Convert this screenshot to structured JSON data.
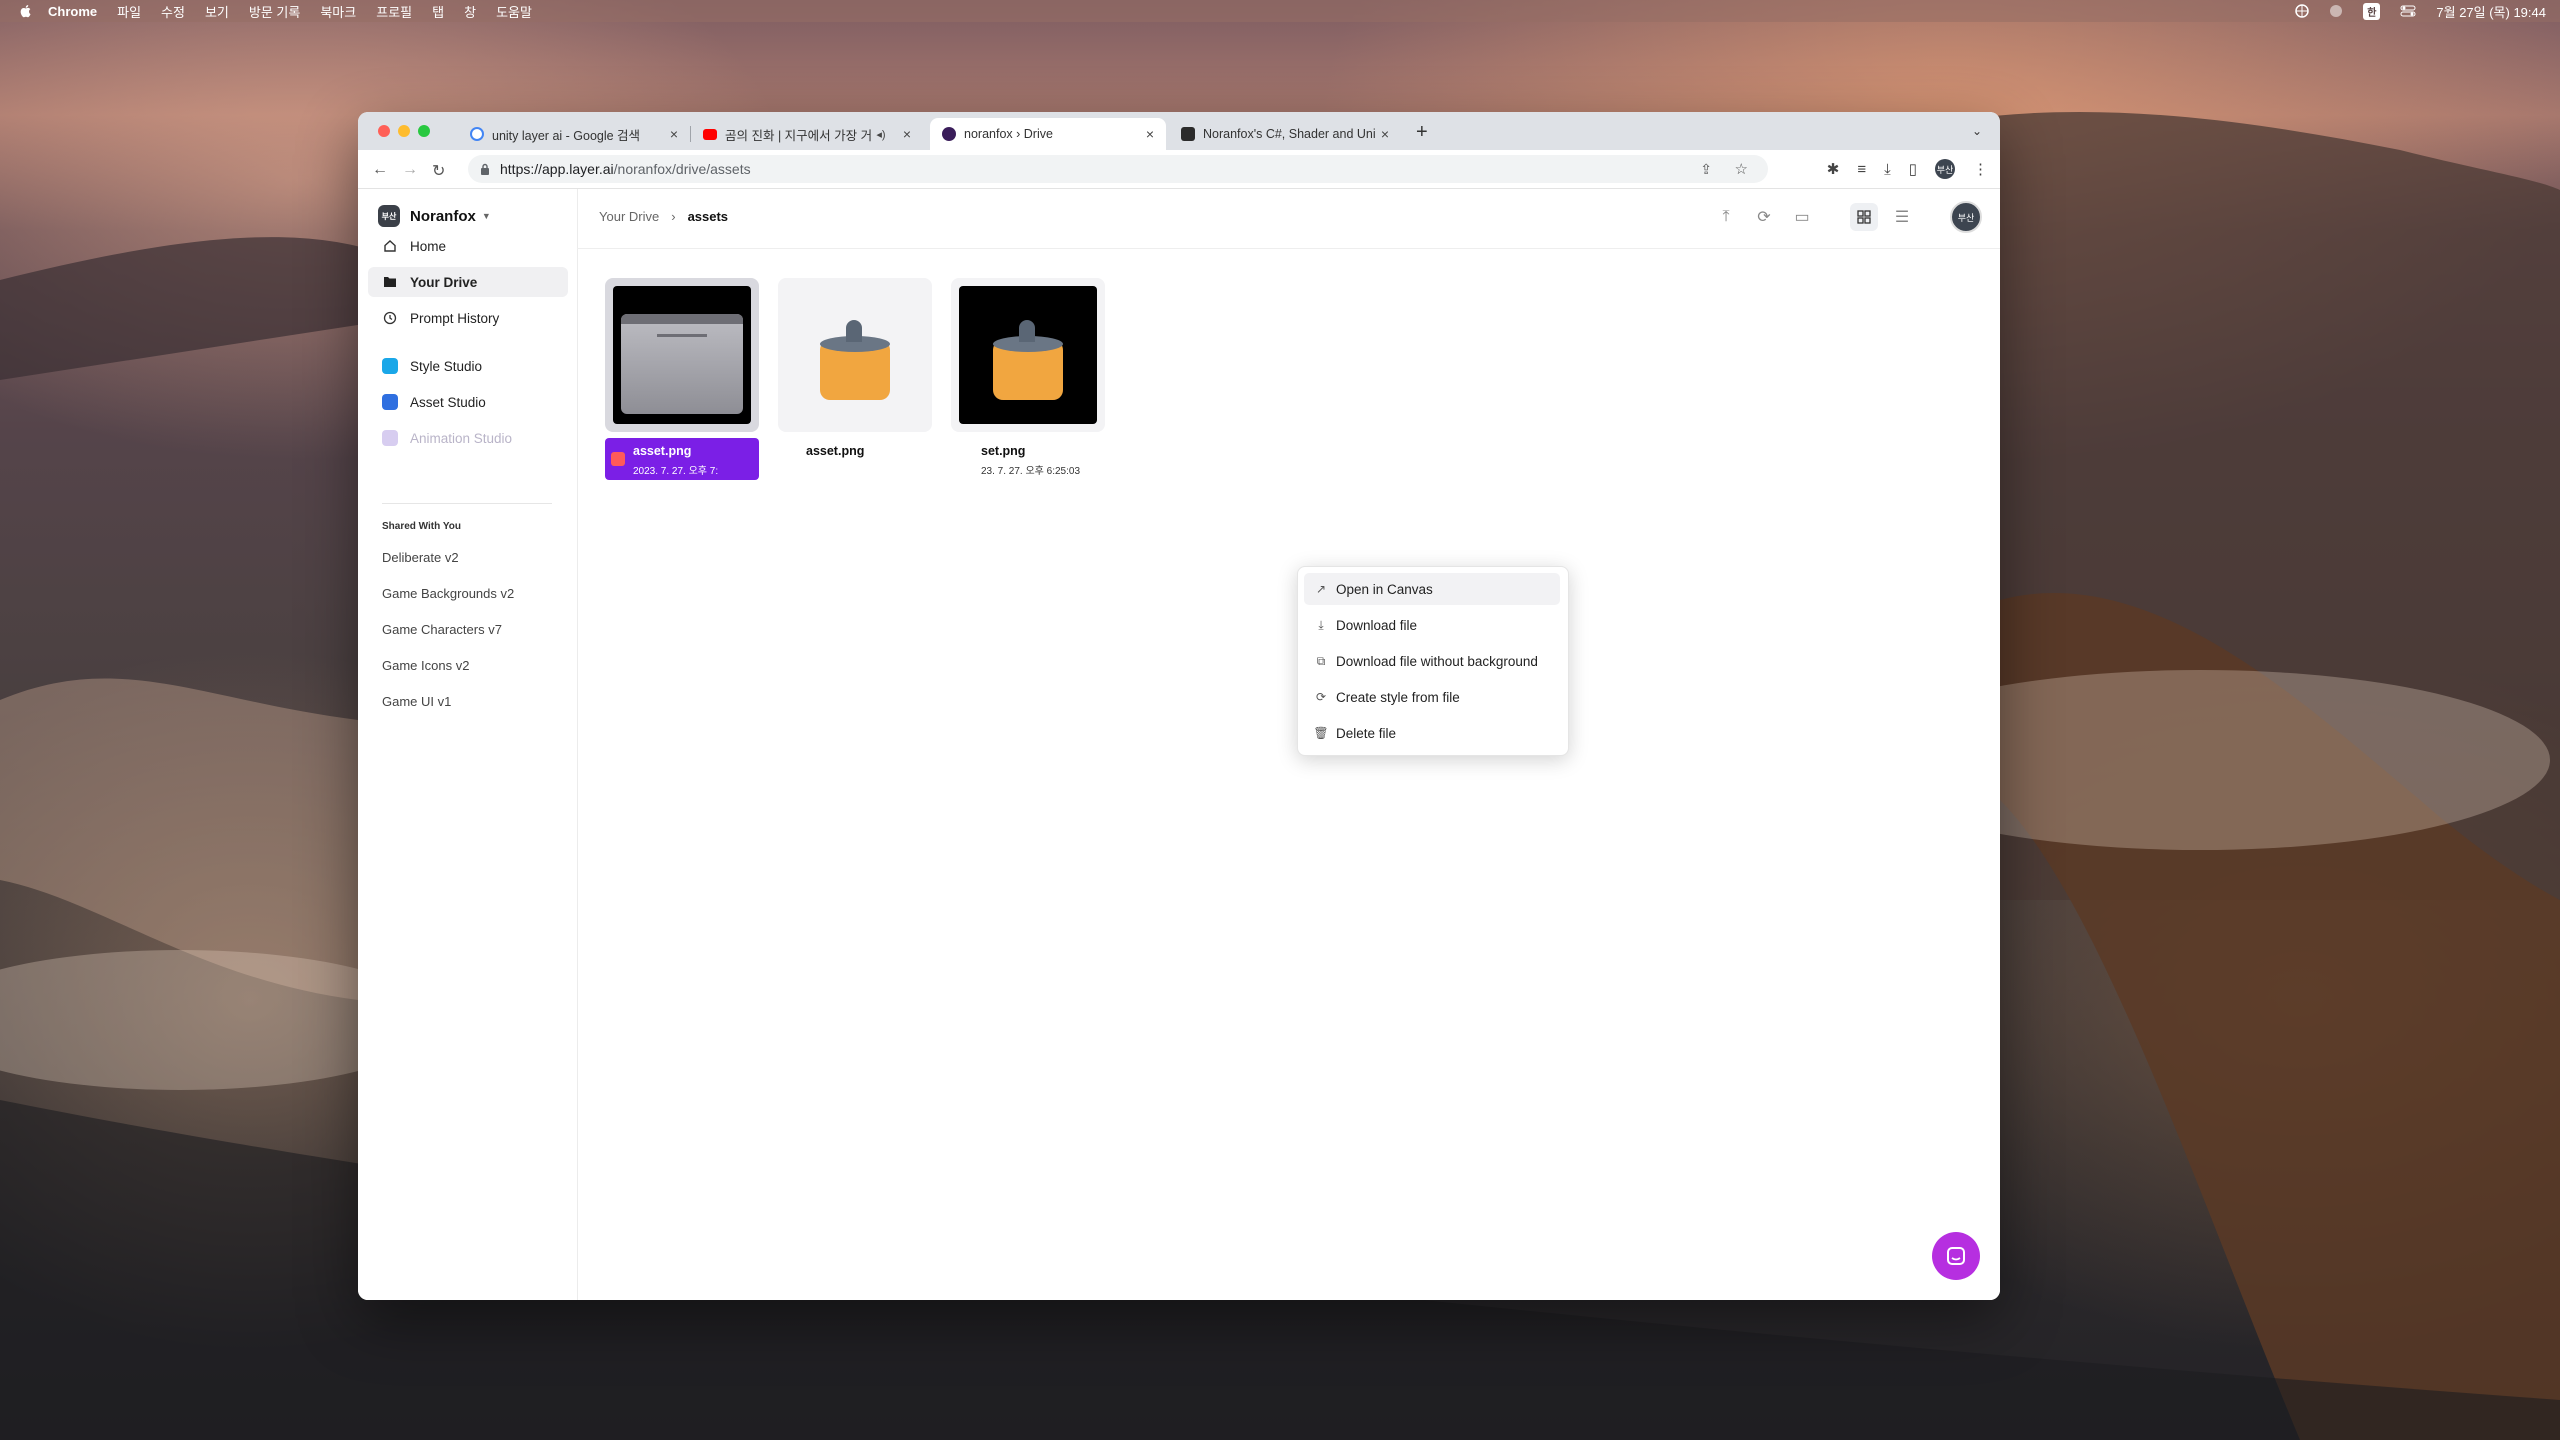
{
  "menubar": {
    "app": "Chrome",
    "items": [
      "파일",
      "수정",
      "보기",
      "방문 기록",
      "북마크",
      "프로필",
      "탭",
      "창",
      "도움말"
    ],
    "ime": "한",
    "datetime": "7월 27일 (목) 19:44"
  },
  "browser": {
    "tabs": [
      {
        "title": "unity layer ai - Google 검색",
        "favicon": "google-icon"
      },
      {
        "title": "곰의 진화 | 지구에서 가장 거대한",
        "favicon": "youtube-icon"
      },
      {
        "title": "noranfox › Drive",
        "favicon": "layer-icon"
      },
      {
        "title": "Noranfox's C#, Shader and Unity",
        "favicon": "blog-icon"
      }
    ],
    "url_host": "https://app.layer.ai",
    "url_path": "/noranfox/drive/assets",
    "profile": "부산"
  },
  "sidebar": {
    "workspace": "Noranfox",
    "workspace_badge": "부산",
    "nav": [
      {
        "label": "Home",
        "icon": "home-icon"
      },
      {
        "label": "Your Drive",
        "icon": "folder-icon"
      },
      {
        "label": "Prompt History",
        "icon": "history-icon"
      }
    ],
    "studios": [
      {
        "label": "Style Studio",
        "icon": "style-studio-icon"
      },
      {
        "label": "Asset Studio",
        "icon": "asset-studio-icon"
      },
      {
        "label": "Animation Studio",
        "icon": "animation-studio-icon"
      }
    ],
    "shared_heading": "Shared With You",
    "shared": [
      "Deliberate v2",
      "Game Backgrounds v2",
      "Game Characters v7",
      "Game Icons v2",
      "Game UI v1"
    ]
  },
  "breadcrumb": {
    "root": "Your Drive",
    "current": "assets"
  },
  "files": [
    {
      "name": "asset.png",
      "date": "2023. 7. 27. 오후 7:",
      "selected": true
    },
    {
      "name": "asset.png",
      "date": "",
      "selected": false
    },
    {
      "name": "set.png",
      "date": "23. 7. 27. 오후 6:25:03",
      "selected": false
    }
  ],
  "context_menu": [
    {
      "label": "Open in Canvas",
      "icon": "open-arrow-icon"
    },
    {
      "label": "Download file",
      "icon": "download-icon"
    },
    {
      "label": "Download file without background",
      "icon": "remove-bg-icon"
    },
    {
      "label": "Create style from file",
      "icon": "style-add-icon"
    },
    {
      "label": "Delete file",
      "icon": "trash-icon"
    }
  ],
  "user_avatar": "부산",
  "colors": {
    "accent": "#7b1fe6",
    "fab": "#b62fe0"
  }
}
